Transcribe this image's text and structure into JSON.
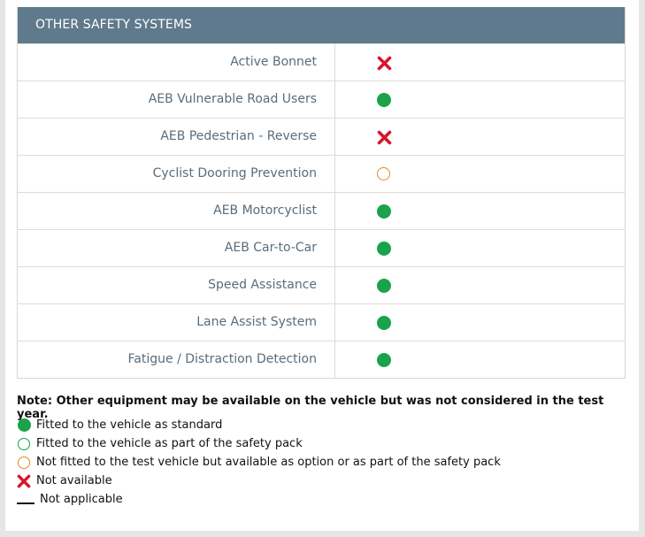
{
  "section": {
    "title": "OTHER SAFETY SYSTEMS"
  },
  "rows": [
    {
      "label": "Active Bonnet",
      "status": "not-available"
    },
    {
      "label": "AEB Vulnerable Road Users",
      "status": "standard"
    },
    {
      "label": "AEB Pedestrian - Reverse",
      "status": "not-available"
    },
    {
      "label": "Cyclist Dooring Prevention",
      "status": "option"
    },
    {
      "label": "AEB Motorcyclist",
      "status": "standard"
    },
    {
      "label": "AEB Car-to-Car",
      "status": "standard"
    },
    {
      "label": "Speed Assistance",
      "status": "standard"
    },
    {
      "label": "Lane Assist System",
      "status": "standard"
    },
    {
      "label": "Fatigue / Distraction Detection",
      "status": "standard"
    }
  ],
  "note": "Note: Other equipment may be available on the vehicle but was not considered in the test year.",
  "legend": [
    {
      "icon": "filled-green-circle-icon",
      "text": "Fitted to the vehicle as standard"
    },
    {
      "icon": "open-green-circle-icon",
      "text": "Fitted to the vehicle as part of the safety pack"
    },
    {
      "icon": "open-orange-circle-icon",
      "text": "Not fitted to the test vehicle but available as option or as part of the safety pack"
    },
    {
      "icon": "red-cross-icon",
      "text": "Not available"
    },
    {
      "icon": "dash-icon",
      "text": "Not applicable"
    }
  ],
  "colors": {
    "header_bg": "#5f7a8c",
    "green": "#1aa34a",
    "orange": "#e58a1f",
    "red": "#d9142b"
  }
}
